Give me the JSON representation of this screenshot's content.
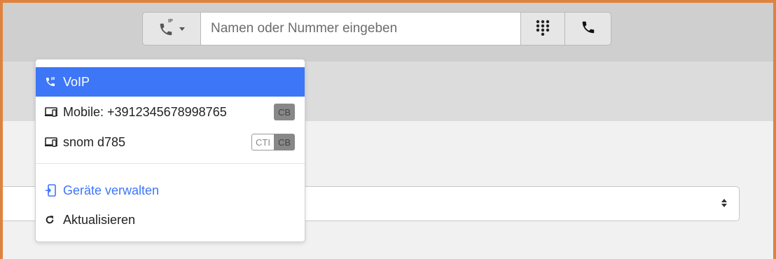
{
  "callbar": {
    "device_badge": "IP",
    "search_placeholder": "Namen oder Nummer eingeben"
  },
  "dropdown": {
    "items": [
      {
        "label": "VoIP",
        "active": true
      },
      {
        "label": "Mobile: +3912345678998765",
        "badges": [
          "CB"
        ]
      },
      {
        "label": "snom d785",
        "badges": [
          "CTI",
          "CB"
        ]
      }
    ],
    "manage_devices": "Geräte verwalten",
    "refresh": "Aktualisieren"
  },
  "colors": {
    "accent": "#3d76f7",
    "frame_border": "#e0823f",
    "topbar": "#cfcfcf"
  },
  "icons": {
    "device_toggle": "phone-ip-icon",
    "dialpad": "dialpad-icon",
    "call": "phone-icon",
    "voip": "phone-ip-icon",
    "device": "devices-icon",
    "manage": "manage-devices-icon",
    "refresh": "refresh-icon",
    "select": "sort-arrows-icon"
  }
}
